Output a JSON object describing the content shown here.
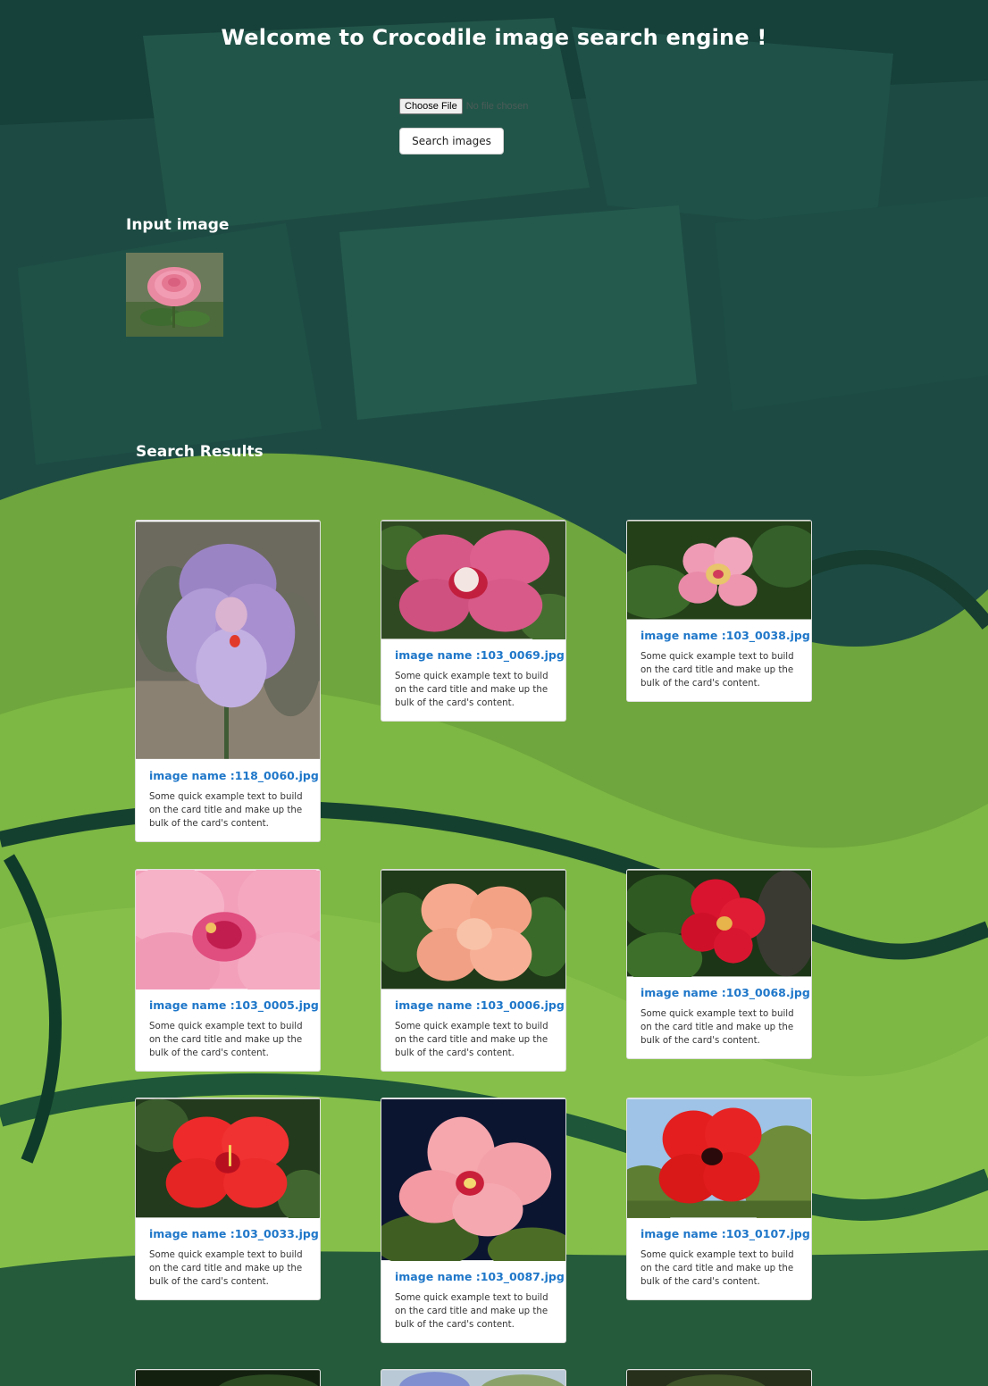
{
  "header": {
    "title": "Welcome to Crocodile image search engine !"
  },
  "upload": {
    "choose_file_label": "Choose File",
    "file_status": "No file chosen",
    "search_button_label": "Search images"
  },
  "input_section": {
    "heading": "Input image"
  },
  "results_section": {
    "heading": "Search Results"
  },
  "results": [
    {
      "title": "image name :118_0060.jpg",
      "text": "Some quick example text to build on the card title and make up the bulk of the card's content."
    },
    {
      "title": "image name :103_0069.jpg",
      "text": "Some quick example text to build on the card title and make up the bulk of the card's content."
    },
    {
      "title": "image name :103_0038.jpg",
      "text": "Some quick example text to build on the card title and make up the bulk of the card's content."
    },
    {
      "title": "image name :103_0005.jpg",
      "text": "Some quick example text to build on the card title and make up the bulk of the card's content."
    },
    {
      "title": "image name :103_0006.jpg",
      "text": "Some quick example text to build on the card title and make up the bulk of the card's content."
    },
    {
      "title": "image name :103_0068.jpg",
      "text": "Some quick example text to build on the card title and make up the bulk of the card's content."
    },
    {
      "title": "image name :103_0033.jpg",
      "text": "Some quick example text to build on the card title and make up the bulk of the card's content."
    },
    {
      "title": "image name :103_0087.jpg",
      "text": "Some quick example text to build on the card title and make up the bulk of the card's content."
    },
    {
      "title": "image name :103_0107.jpg",
      "text": "Some quick example text to build on the card title and make up the bulk of the card's content."
    }
  ],
  "colors": {
    "background_dark": "#1c4a42",
    "background_green": "#7db744",
    "card_title": "#1f77c9",
    "heading_text": "#ffffff"
  }
}
